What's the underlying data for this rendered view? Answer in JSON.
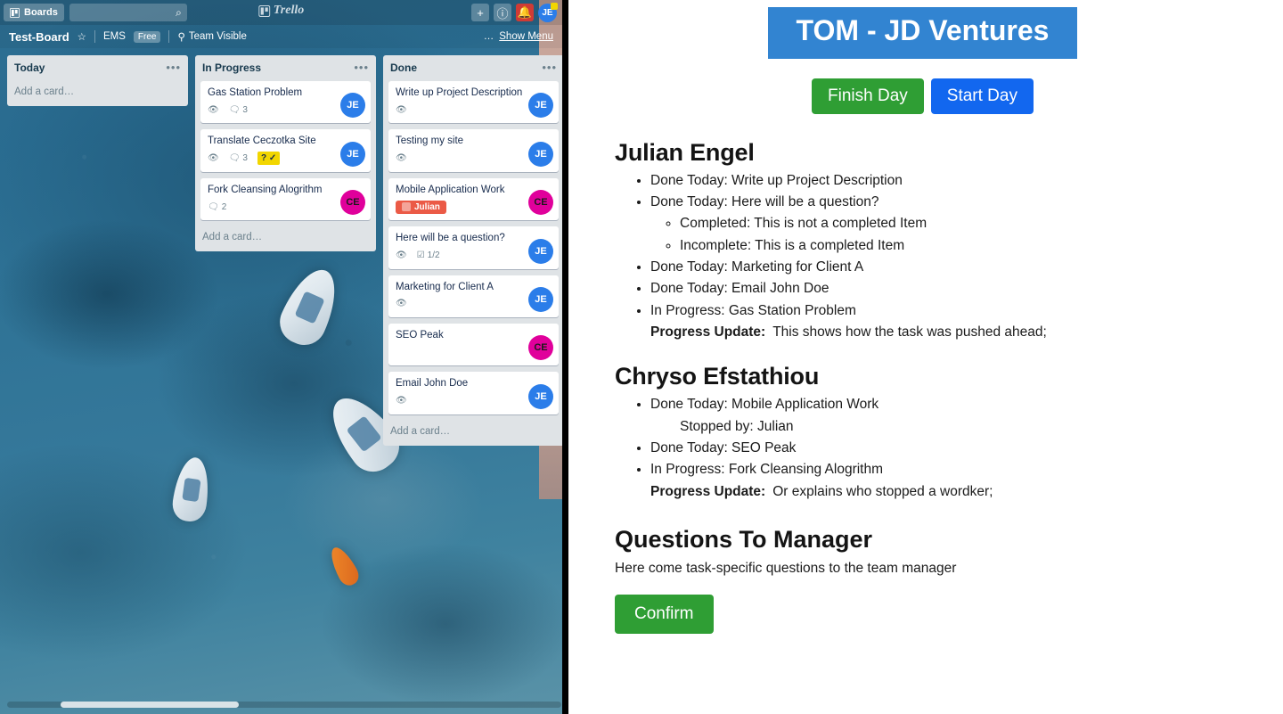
{
  "trello": {
    "topbar": {
      "boards_label": "Boards",
      "search_placeholder": "",
      "search_value": "",
      "search_icon": "search-icon",
      "logo_text": "Trello",
      "add_icon": "plus-icon",
      "info_icon": "info-icon",
      "notifications_icon": "bell-icon",
      "avatar_initials": "JE"
    },
    "board_header": {
      "title": "Test-Board",
      "star_icon": "star-icon",
      "team_name": "EMS",
      "plan_badge": "Free",
      "visibility_icon": "person-icon",
      "visibility": "Team Visible",
      "more_icon": "ellipsis-icon",
      "show_menu": "Show Menu"
    },
    "lists": [
      {
        "title": "Today",
        "menu_icon": "ellipsis-icon",
        "add_card": "Add a card…",
        "cards": []
      },
      {
        "title": "In Progress",
        "menu_icon": "ellipsis-icon",
        "add_card": "Add a card…",
        "cards": [
          {
            "title": "Gas Station Problem",
            "watch": true,
            "comments": "3",
            "avatar": "JE",
            "avatar_color": "#2b7de9"
          },
          {
            "title": "Translate Ceczotka Site",
            "watch": true,
            "comments": "3",
            "yellow_badge": "? ✓",
            "avatar": "JE",
            "avatar_color": "#2b7de9"
          },
          {
            "title": "Fork Cleansing Alogrithm",
            "watch": false,
            "comments": "2",
            "avatar": "CE",
            "avatar_color": "#e0009b"
          }
        ]
      },
      {
        "title": "Done",
        "menu_icon": "ellipsis-icon",
        "add_card": "Add a card…",
        "cards": [
          {
            "title": "Write up Project Description",
            "watch": true,
            "avatar": "JE",
            "avatar_color": "#2b7de9"
          },
          {
            "title": "Testing my site",
            "watch": true,
            "avatar": "JE",
            "avatar_color": "#2b7de9"
          },
          {
            "title": "Mobile Application Work",
            "label": "Julian",
            "label_color": "#eb5a46",
            "avatar": "CE",
            "avatar_color": "#e0009b"
          },
          {
            "title": "Here will be a question?",
            "watch": true,
            "checklist": "1/2",
            "avatar": "JE",
            "avatar_color": "#2b7de9"
          },
          {
            "title": "Marketing for Client A",
            "watch": true,
            "avatar": "JE",
            "avatar_color": "#2b7de9"
          },
          {
            "title": "SEO Peak",
            "watch": false,
            "avatar": "CE",
            "avatar_color": "#e0009b"
          },
          {
            "title": "Email John Doe",
            "watch": true,
            "avatar": "JE",
            "avatar_color": "#2b7de9"
          }
        ]
      }
    ]
  },
  "report": {
    "title": "TOM - JD Ventures",
    "finish_day_label": "Finish Day",
    "start_day_label": "Start Day",
    "accent_blue": "#3284d1",
    "accent_green": "#2f9e34",
    "accent_blue_button": "#1267ef",
    "people": [
      {
        "name": "Julian Engel",
        "items": [
          {
            "text": "Done Today: Write up Project Description"
          },
          {
            "text": "Done Today: Here will be a question?",
            "sub": [
              "Completed: This is not a completed Item",
              "Incomplete: This is a completed Item"
            ]
          },
          {
            "text": "Done Today: Marketing for Client A"
          },
          {
            "text": "Done Today: Email John Doe"
          },
          {
            "text": "In Progress: Gas Station Problem"
          }
        ],
        "progress_label": "Progress Update:",
        "progress_text": "This shows how the task was pushed ahead;"
      },
      {
        "name": "Chryso Efstathiou",
        "items": [
          {
            "text": "Done Today: Mobile Application Work",
            "plain": "Stopped by: Julian"
          },
          {
            "text": "Done Today: SEO Peak"
          },
          {
            "text": "In Progress: Fork Cleansing Alogrithm"
          }
        ],
        "progress_label": "Progress Update:",
        "progress_text": "Or explains who stopped a wordker;"
      }
    ],
    "questions_heading": "Questions To Manager",
    "questions_text": "Here come task-specific questions to the team manager",
    "confirm_label": "Confirm"
  }
}
